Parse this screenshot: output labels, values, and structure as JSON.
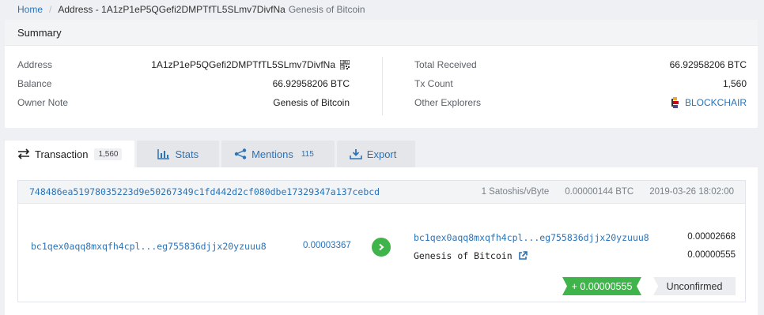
{
  "breadcrumb": {
    "home": "Home",
    "separator": "/",
    "current": "Address - 1A1zP1eP5QGefi2DMPTfTL5SLmv7DivfNa",
    "note": "Genesis of Bitcoin"
  },
  "summary": {
    "title": "Summary",
    "left": [
      {
        "label": "Address",
        "value": "1A1zP1eP5QGefi2DMPTfTL5SLmv7DivfNa"
      },
      {
        "label": "Balance",
        "value": "66.92958206 BTC"
      },
      {
        "label": "Owner Note",
        "value": "Genesis of Bitcoin"
      }
    ],
    "right": [
      {
        "label": "Total Received",
        "value": "66.92958206 BTC"
      },
      {
        "label": "Tx Count",
        "value": "1,560"
      },
      {
        "label": "Other Explorers",
        "value": "BLOCKCHAIR"
      }
    ]
  },
  "tabs": [
    {
      "label": "Transaction",
      "badge": "1,560",
      "icon": "transfer-icon"
    },
    {
      "label": "Stats",
      "icon": "bar-chart-icon"
    },
    {
      "label": "Mentions",
      "count": "115",
      "icon": "share-icon"
    },
    {
      "label": "Export",
      "icon": "download-icon"
    }
  ],
  "transaction": {
    "hash": "748486ea51978035223d9e50267349c1fd442d2cf080dbe17329347a137cebcd",
    "fee_rate": "1 Satoshis/vByte",
    "fee": "0.00000144 BTC",
    "time": "2019-03-26 18:02:00",
    "input": {
      "address": "bc1qex0aqq8mxqfh4cpl...eg755836djjx20yzuuu8",
      "amount": "0.00003367"
    },
    "outputs": [
      {
        "address": "bc1qex0aqq8mxqfh4cpl...eg755836djjx20yzuuu8",
        "amount": "0.00002668"
      },
      {
        "address": "Genesis of Bitcoin",
        "amount": "0.00000555"
      }
    ],
    "delta": "+ 0.00000555",
    "status": "Unconfirmed"
  },
  "colors": {
    "link": "#2a73b8",
    "positive": "#3fb44a",
    "background": "#eef0f3"
  }
}
